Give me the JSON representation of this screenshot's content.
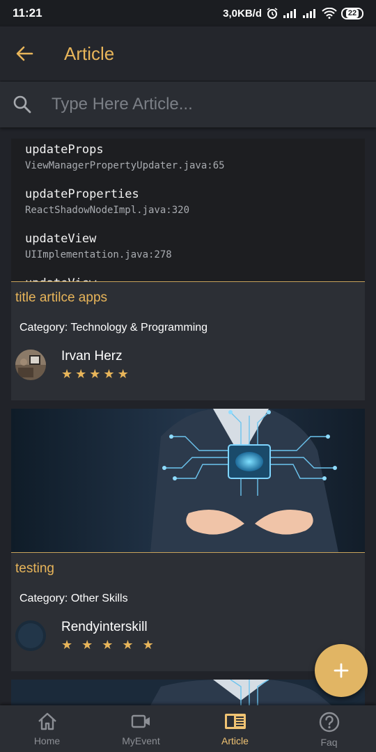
{
  "status": {
    "time": "11:21",
    "speed": "3,0KB/d",
    "battery": "22"
  },
  "header": {
    "title": "Article",
    "back_icon": "arrow-left-icon"
  },
  "search": {
    "placeholder": "Type Here Article..."
  },
  "error_stack": [
    {
      "method": "updateProps",
      "file": "ViewManagerPropertyUpdater.java:65"
    },
    {
      "method": "updateProperties",
      "file": "ReactShadowNodeImpl.java:320"
    },
    {
      "method": "updateView",
      "file": "UIImplementation.java:278"
    },
    {
      "method": "updateView",
      "file": ""
    }
  ],
  "articles": [
    {
      "title": "title artilce apps",
      "category": "Category: Technology & Programming",
      "author": "Irvan Herz",
      "rating": 5
    },
    {
      "title": "testing",
      "category": "Category: Other Skills",
      "author": "Rendyinterskill",
      "rating": 5
    }
  ],
  "nav": [
    {
      "label": "Home",
      "icon": "home-icon",
      "active": false
    },
    {
      "label": "MyEvent",
      "icon": "video-camera-icon",
      "active": false
    },
    {
      "label": "Article",
      "icon": "article-icon",
      "active": true
    },
    {
      "label": "Faq",
      "icon": "help-icon",
      "active": false
    }
  ],
  "colors": {
    "accent": "#e8b55a",
    "background": "#212329",
    "card": "#2c2f35"
  }
}
